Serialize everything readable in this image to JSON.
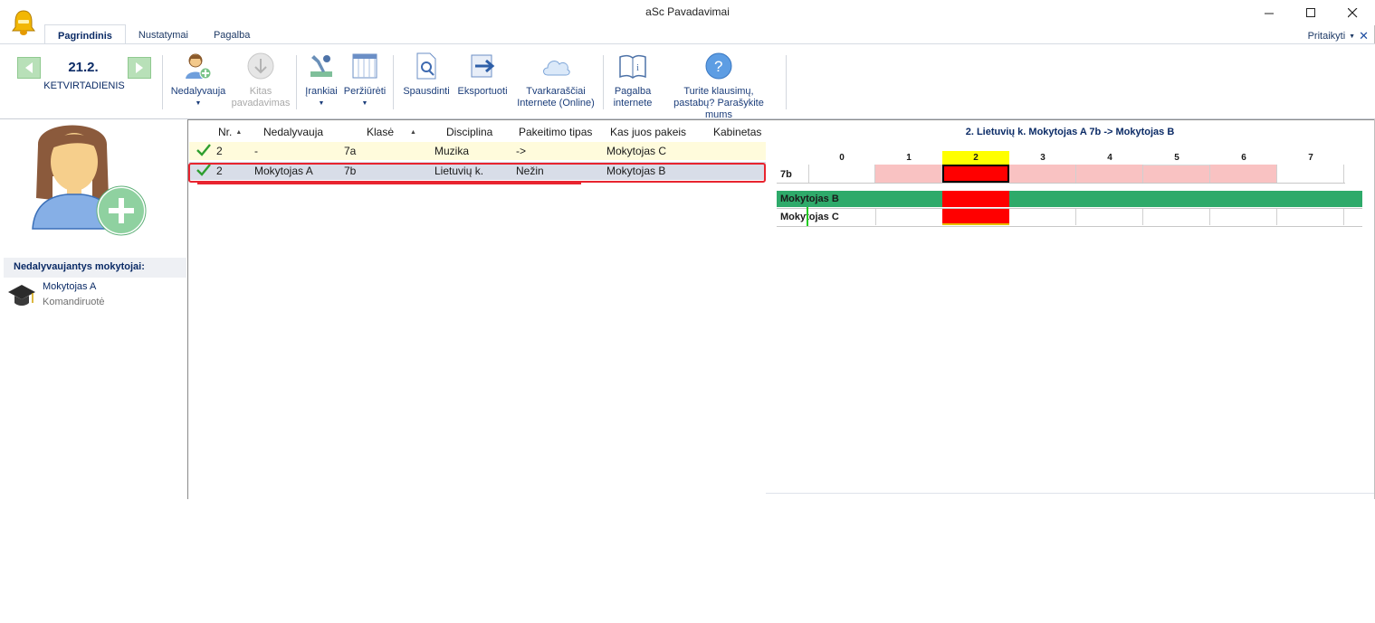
{
  "window": {
    "title": "aSc Pavadavimai"
  },
  "tabs": [
    {
      "label": "Pagrindinis",
      "active": true
    },
    {
      "label": "Nustatymai",
      "active": false
    },
    {
      "label": "Pagalba",
      "active": false
    }
  ],
  "ribbon_right": {
    "label": "Pritaikyti"
  },
  "date": {
    "value": "21.2.",
    "weekday": "KETVIRTADIENIS"
  },
  "ribbon": {
    "nedalyvauja": "Nedalyvauja",
    "kitas_1": "Kitas",
    "kitas_2": "pavadavimas",
    "irankiai": "Įrankiai",
    "perziureti": "Peržiūrėti",
    "spausdinti": "Spausdinti",
    "eksportuoti": "Eksportuoti",
    "online_1": "Tvarkaraščiai",
    "online_2": "Internete (Online)",
    "pagalba_1": "Pagalba",
    "pagalba_2": "internete",
    "klausimu_1": "Turite klausimų,",
    "klausimu_2": "pastabų? Parašykite mums"
  },
  "absent": {
    "header": "Nedalyvaujantys mokytojai:",
    "items": [
      {
        "name": "Mokytojas A",
        "reason": "Komandiruotė"
      }
    ]
  },
  "table": {
    "columns": [
      "Nr.",
      "Nedalyvauja",
      "Klasė",
      "Disciplina",
      "Pakeitimo tipas",
      "Kas juos pakeis",
      "Kabinetas"
    ],
    "rows": [
      {
        "nr": "2",
        "absent": "-",
        "class": "7a",
        "subject": "Muzika",
        "type": "->",
        "substitute": "Mokytojas C",
        "room": ""
      },
      {
        "nr": "2",
        "absent": "Mokytojas A",
        "class": "7b",
        "subject": "Lietuvių k.",
        "type": "Nežin",
        "substitute": "Mokytojas B",
        "room": ""
      }
    ]
  },
  "schedule": {
    "title": "2. Lietuvių k. Mokytojas A 7b -> Mokytojas B",
    "periods": [
      "0",
      "1",
      "2",
      "3",
      "4",
      "5",
      "6",
      "7"
    ],
    "highlight_period": "2",
    "class_label": "7b",
    "teachers": [
      "Mokytojas B",
      "Mokytojas C"
    ]
  },
  "colors": {
    "accent": "#0b2b66",
    "selection": "#e8242f",
    "highlight": "#ffff00",
    "busy": "#ff0000",
    "free": "#2eaa6a",
    "lesson": "#f9c2c2"
  }
}
